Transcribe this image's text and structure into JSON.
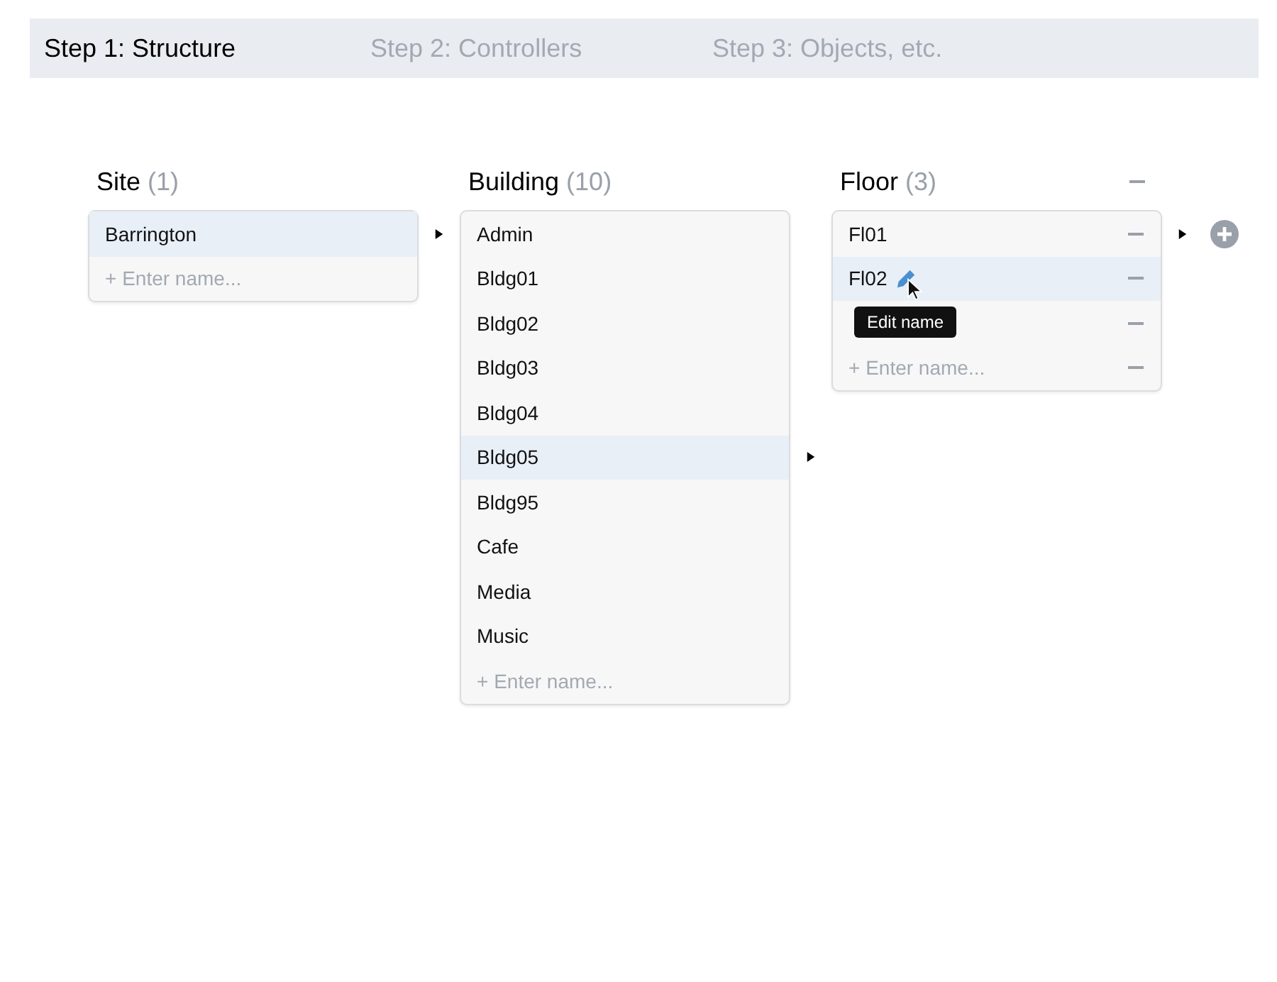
{
  "tabs": [
    {
      "label": "Step 1: Structure",
      "selected": true
    },
    {
      "label": "Step 2: Controllers",
      "selected": false
    },
    {
      "label": "Step 3: Objects, etc.",
      "selected": false
    }
  ],
  "columns": [
    {
      "title": "Site",
      "count": "(1)",
      "removable": false,
      "placeholder": "+ Enter name...",
      "items": [
        {
          "name": "Barrington",
          "selected": true,
          "expanded": true
        }
      ]
    },
    {
      "title": "Building",
      "count": "(10)",
      "removable": false,
      "placeholder": "+ Enter name...",
      "items": [
        {
          "name": "Admin",
          "selected": false,
          "expanded": false
        },
        {
          "name": "Bldg01",
          "selected": false,
          "expanded": false
        },
        {
          "name": "Bldg02",
          "selected": false,
          "expanded": false
        },
        {
          "name": "Bldg03",
          "selected": false,
          "expanded": false
        },
        {
          "name": "Bldg04",
          "selected": false,
          "expanded": false
        },
        {
          "name": "Bldg05",
          "selected": true,
          "expanded": true
        },
        {
          "name": "Bldg95",
          "selected": false,
          "expanded": false
        },
        {
          "name": "Cafe",
          "selected": false,
          "expanded": false
        },
        {
          "name": "Media",
          "selected": false,
          "expanded": false
        },
        {
          "name": "Music",
          "selected": false,
          "expanded": false
        }
      ]
    },
    {
      "title": "Floor",
      "count": "(3)",
      "removable": true,
      "placeholder": "+ Enter name...",
      "items": [
        {
          "name": "Fl01",
          "selected": false,
          "expanded": true,
          "addable": true
        },
        {
          "name": "Fl02",
          "selected": true,
          "expanded": false,
          "tooltip": "Edit name"
        },
        {
          "selected": false,
          "expanded": false
        }
      ]
    }
  ]
}
